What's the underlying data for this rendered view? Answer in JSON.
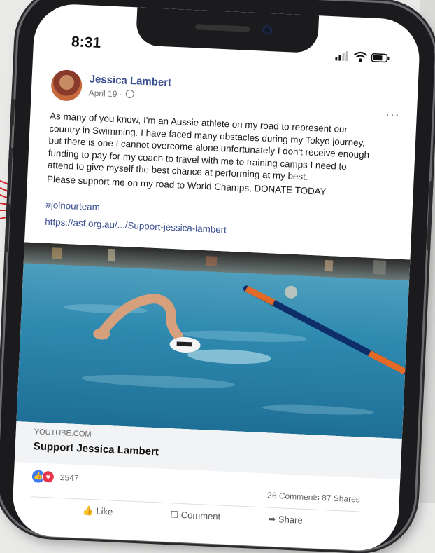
{
  "status_bar": {
    "time": "8:31"
  },
  "post": {
    "author": "Jessica Lambert",
    "date": "April 19 ·",
    "more": "···",
    "body_lines": [
      "As many of you know, I'm an Aussie athlete on my road to represent our",
      "country in Swimming. I have faced many obstacles during my Tokyo journey,",
      "but there is one I cannot overcome alone unfortunately I don't receive enough",
      "funding to pay for my coach to travel with me to training camps I need to",
      "attend to give myself the best chance at performing at my best.",
      "Please support me on my road to World Champs, DONATE TODAY"
    ],
    "hashtag": "#joinourteam",
    "link": "https://asf.org.au/.../Support-jessica-lambert"
  },
  "link_card": {
    "domain": "YOUTUBE.COM",
    "title": "Support Jessica Lambert"
  },
  "reactions": {
    "count": "2547",
    "comments": "26 Comments",
    "shares": "87 Shares"
  },
  "actions": {
    "like": "Like",
    "comment": "Comment",
    "share": "Share"
  },
  "colors": {
    "link": "#3b4f91",
    "like_reaction": "#3f7bf4",
    "love_reaction": "#e8344c",
    "annotation_arrow": "#d8202a"
  }
}
